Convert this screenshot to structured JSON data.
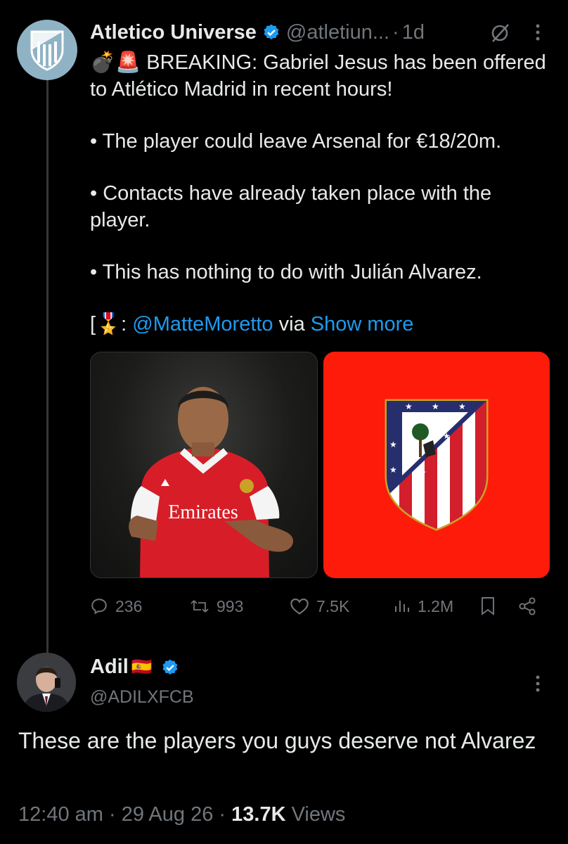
{
  "tweet": {
    "author_name": "Atletico Universe",
    "handle": "@atletiun...",
    "time": "1d",
    "emoji_prefix": "💣🚨",
    "line1": "BREAKING: Gabriel Jesus has been offered to Atlético Madrid in recent hours!",
    "bullet1": "• The player could leave Arsenal for €18/20m.",
    "bullet2": "• Contacts have already taken place with the player.",
    "bullet3": "• This has nothing to do with Julián Alvarez.",
    "source_prefix": "[🎖️: ",
    "source_mention": "@MatteMoretto",
    "source_via": " via ",
    "show_more": "Show more",
    "images": [
      {
        "subject": "Gabriel Jesus in Arsenal kit",
        "shirt_text": "Emirates"
      },
      {
        "subject": "Atlético Madrid crest"
      }
    ],
    "stats": {
      "replies": "236",
      "reposts": "993",
      "likes": "7.5K",
      "views": "1.2M"
    }
  },
  "reply": {
    "name": "Adil",
    "flag": "🇪🇸",
    "handle": "@ADILXFCB",
    "text": "These are the players you guys deserve not Alvarez",
    "time": "12:40 am",
    "date": "29 Aug 26",
    "views_count": "13.7K",
    "views_label": "Views"
  },
  "colors": {
    "background": "#000000",
    "accent": "#1d9bf0",
    "muted": "#71767b",
    "crest_bg": "#ff1b0a"
  },
  "icons": [
    "reply-icon",
    "repost-icon",
    "like-icon",
    "views-icon",
    "bookmark-icon",
    "share-icon",
    "grok-icon",
    "more-icon",
    "verified-icon"
  ]
}
